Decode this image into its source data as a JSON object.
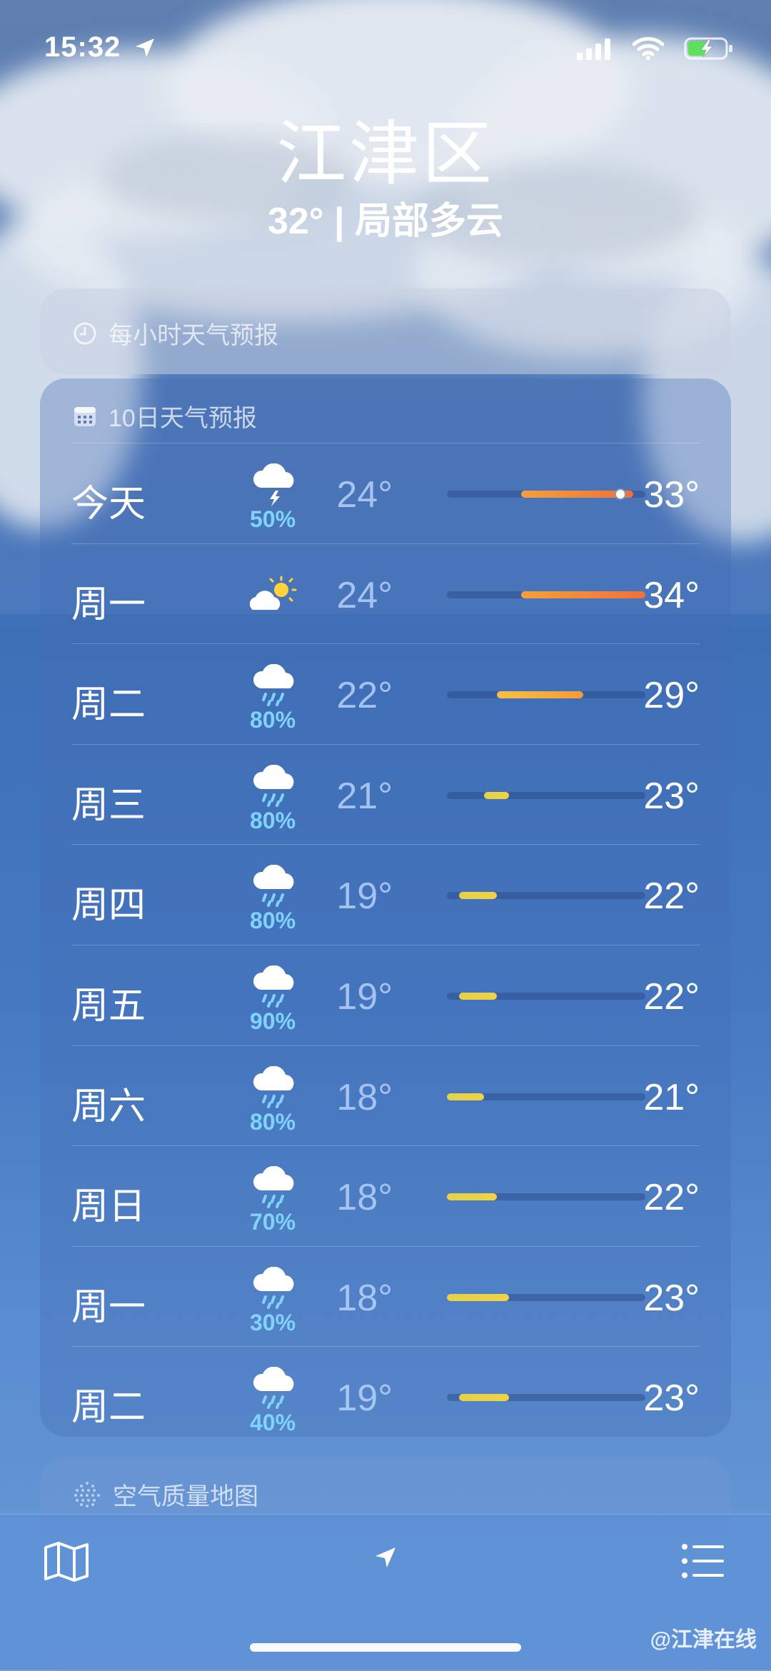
{
  "status": {
    "time": "15:32"
  },
  "header": {
    "city": "江津区",
    "condition": "32° | 局部多云"
  },
  "hourly": {
    "title": "每小时天气预报"
  },
  "ten_day": {
    "title": "10日天气预报",
    "days": [
      {
        "day": "今天",
        "icon": "thunderstorm-icon",
        "pop": "50%",
        "low": "24°",
        "high": "33°"
      },
      {
        "day": "周一",
        "icon": "partly-sunny-icon",
        "pop": "",
        "low": "24°",
        "high": "34°"
      },
      {
        "day": "周二",
        "icon": "rain-icon",
        "pop": "80%",
        "low": "22°",
        "high": "29°"
      },
      {
        "day": "周三",
        "icon": "rain-icon",
        "pop": "80%",
        "low": "21°",
        "high": "23°"
      },
      {
        "day": "周四",
        "icon": "rain-icon",
        "pop": "80%",
        "low": "19°",
        "high": "22°"
      },
      {
        "day": "周五",
        "icon": "rain-icon",
        "pop": "90%",
        "low": "19°",
        "high": "22°"
      },
      {
        "day": "周六",
        "icon": "rain-icon",
        "pop": "80%",
        "low": "18°",
        "high": "21°"
      },
      {
        "day": "周日",
        "icon": "rain-icon",
        "pop": "70%",
        "low": "18°",
        "high": "22°"
      },
      {
        "day": "周一",
        "icon": "rain-icon",
        "pop": "30%",
        "low": "18°",
        "high": "23°"
      },
      {
        "day": "周二",
        "icon": "rain-icon",
        "pop": "40%",
        "low": "19°",
        "high": "23°"
      }
    ],
    "current_temp": 32,
    "range_min": 18,
    "range_max": 34
  },
  "air": {
    "title": "空气质量地图"
  },
  "watermark": "@江津在线"
}
